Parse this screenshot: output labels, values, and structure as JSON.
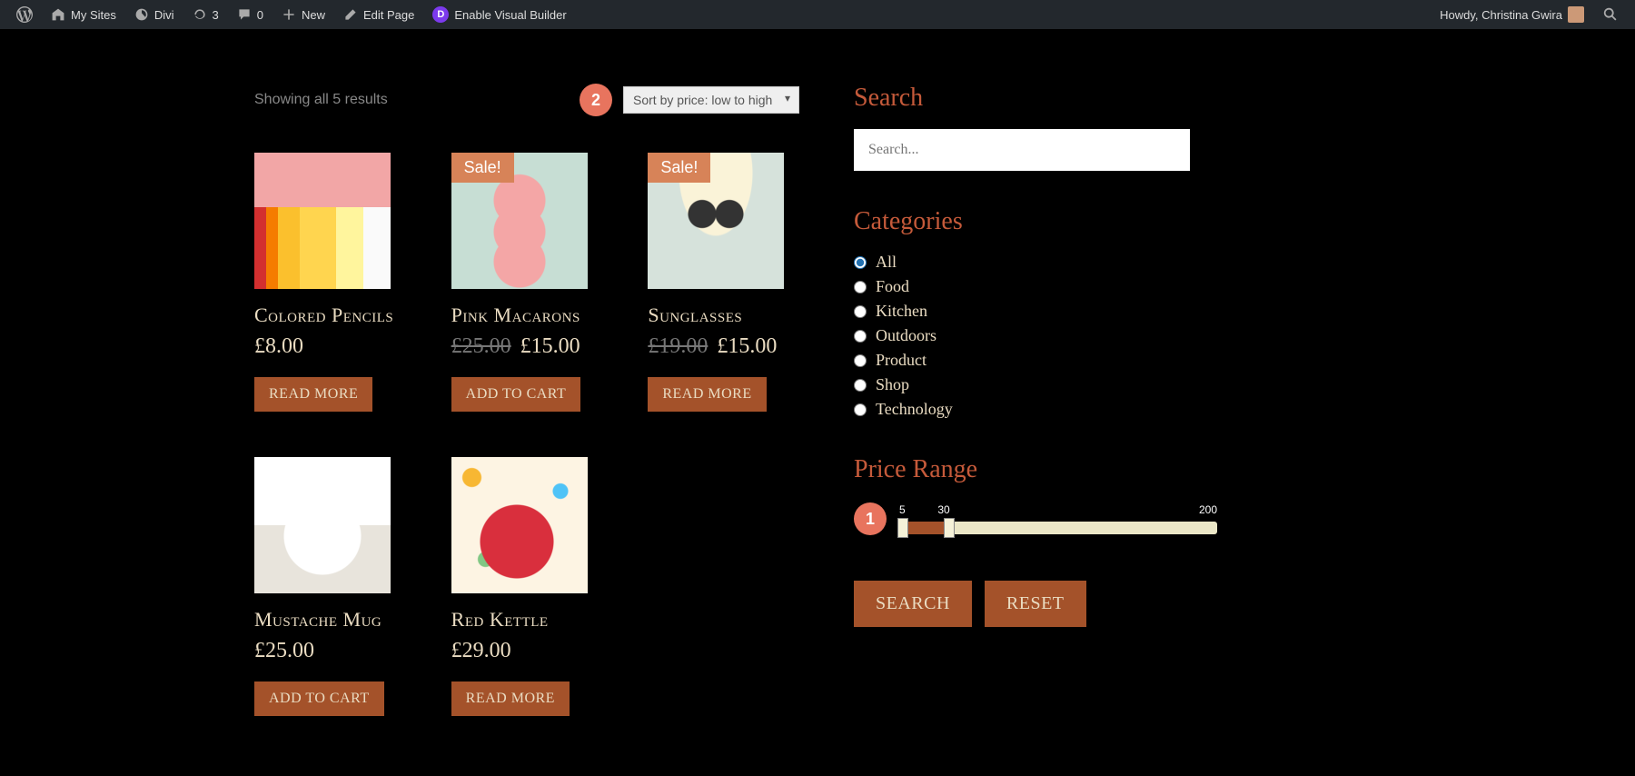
{
  "adminbar": {
    "my_sites": "My Sites",
    "site": "Divi",
    "updates": "3",
    "comments": "0",
    "new": "New",
    "edit_page": "Edit Page",
    "visual_builder": "Enable Visual Builder",
    "greeting": "Howdy, Christina Gwira"
  },
  "results_count": "Showing all 5 results",
  "sort": {
    "selected": "Sort by price: low to high"
  },
  "annotations": {
    "one": "1",
    "two": "2"
  },
  "products": [
    {
      "title": "Colored Pencils",
      "price": "£8.00",
      "old_price": "",
      "btn": "READ MORE",
      "sale": false
    },
    {
      "title": "Pink Macarons",
      "price": "£15.00",
      "old_price": "£25.00",
      "btn": "ADD TO CART",
      "sale": true,
      "sale_label": "Sale!"
    },
    {
      "title": "Sunglasses",
      "price": "£15.00",
      "old_price": "£19.00",
      "btn": "READ MORE",
      "sale": true,
      "sale_label": "Sale!"
    },
    {
      "title": "Mustache Mug",
      "price": "£25.00",
      "old_price": "",
      "btn": "ADD TO CART",
      "sale": false
    },
    {
      "title": "Red Kettle",
      "price": "£29.00",
      "old_price": "",
      "btn": "READ MORE",
      "sale": false
    }
  ],
  "sidebar": {
    "search_title": "Search",
    "search_placeholder": "Search...",
    "categories_title": "Categories",
    "categories": [
      "All",
      "Food",
      "Kitchen",
      "Outdoors",
      "Product",
      "Shop",
      "Technology"
    ],
    "selected_category": "All",
    "price_range_title": "Price Range",
    "price_min": "5",
    "price_lo": "30",
    "price_max": "200",
    "search_btn": "SEARCH",
    "reset_btn": "RESET"
  }
}
